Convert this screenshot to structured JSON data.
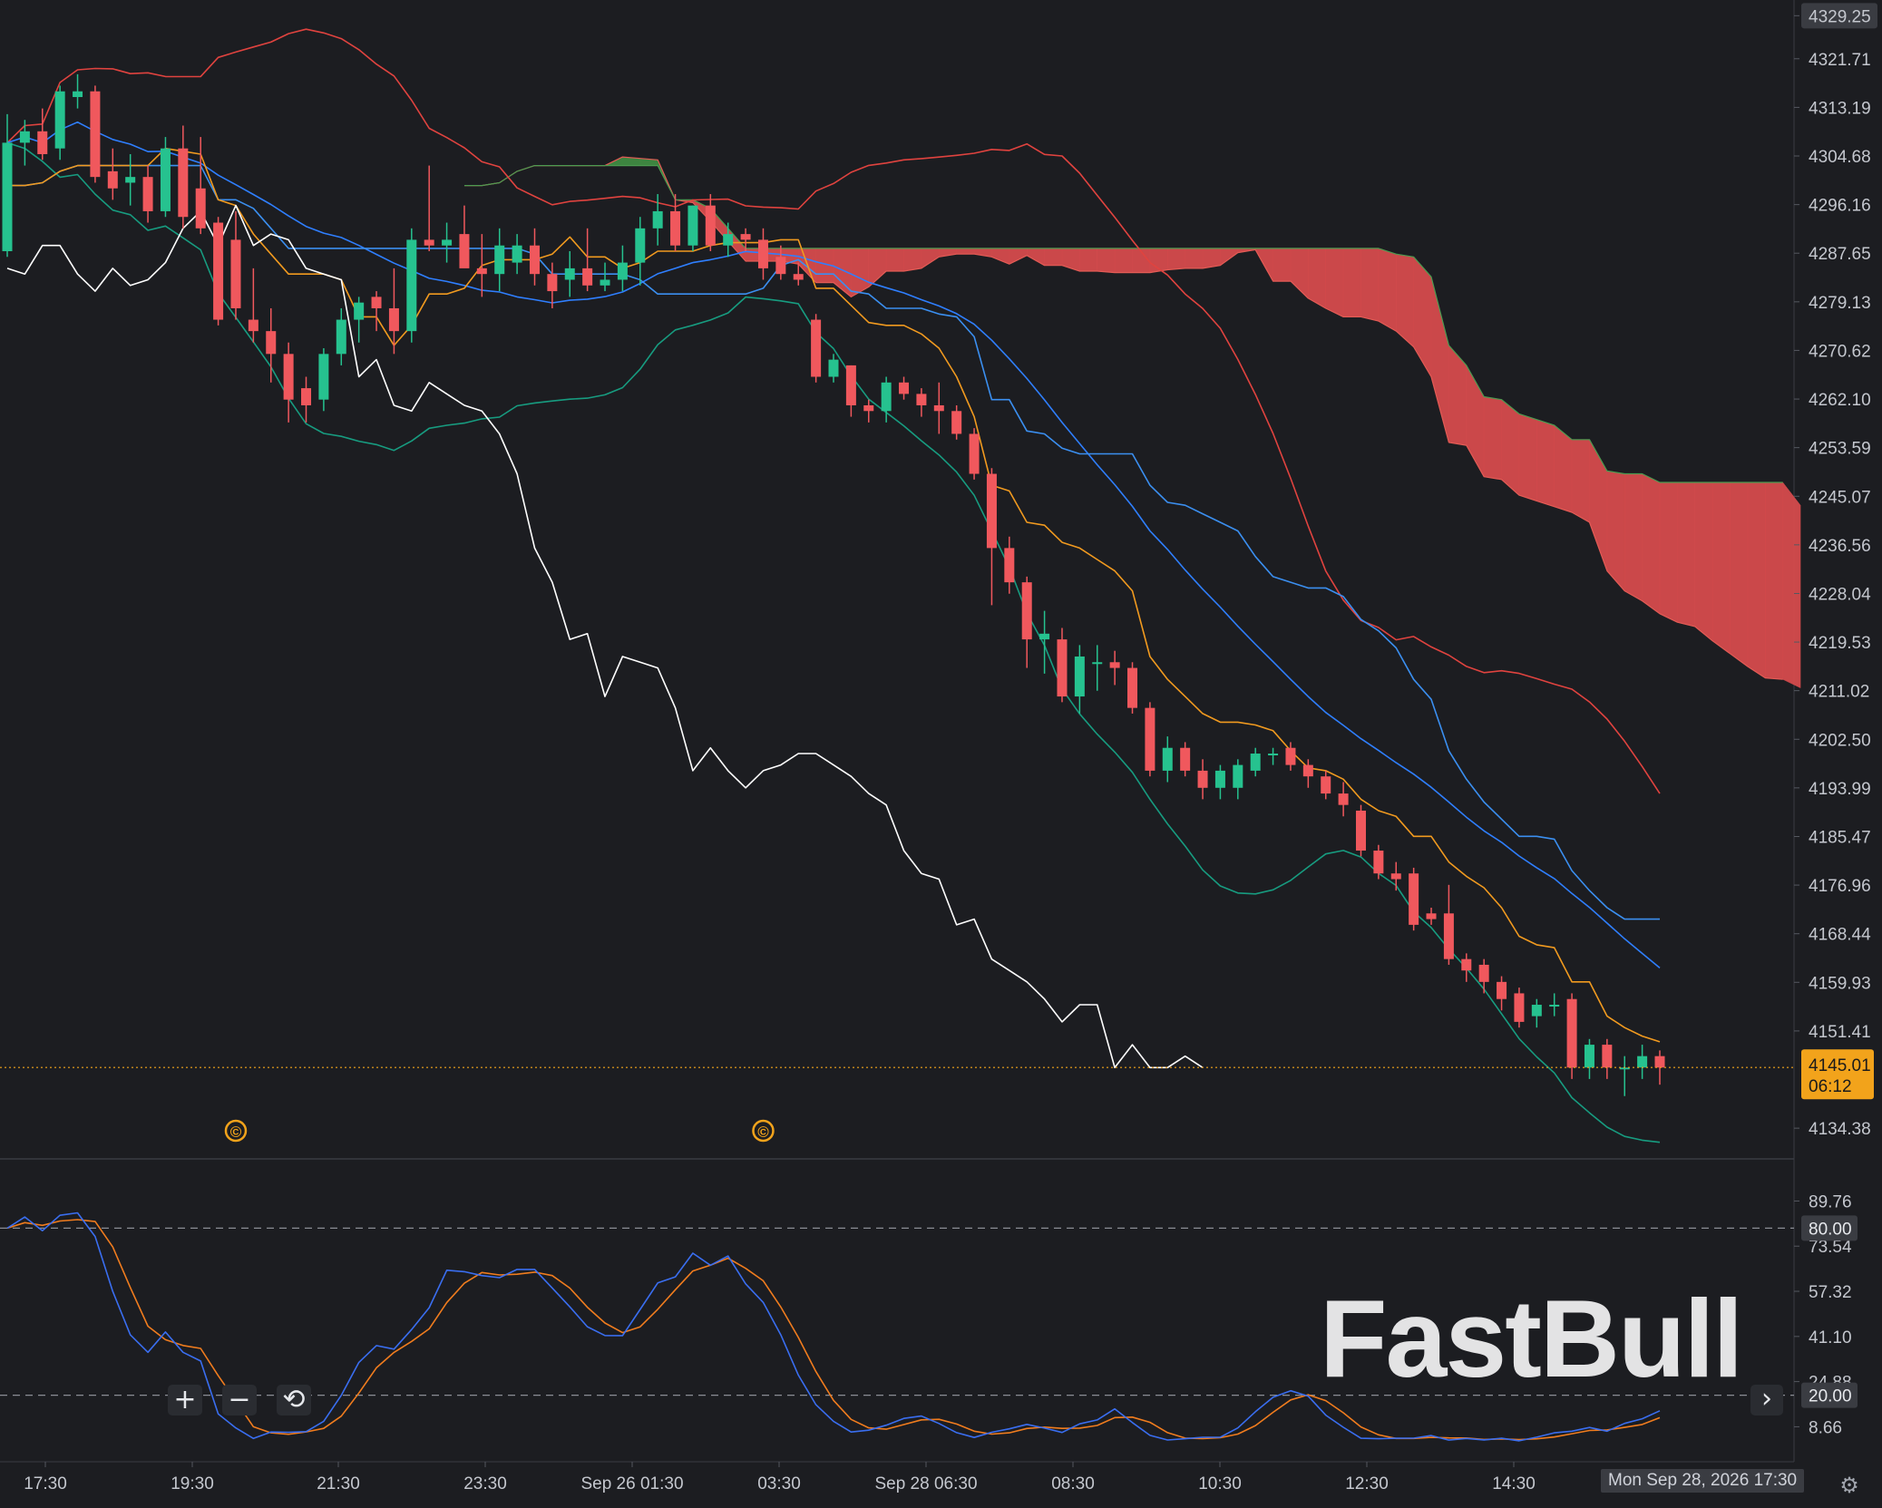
{
  "chart_data": {
    "type": "candlestick",
    "watermark": "FastBull",
    "price_axis": {
      "ylim": [
        4129.0,
        4332.0
      ],
      "ticks": [
        "4329.25",
        "4321.71",
        "4313.19",
        "4304.68",
        "4296.16",
        "4287.65",
        "4279.13",
        "4270.62",
        "4262.10",
        "4253.59",
        "4245.07",
        "4236.56",
        "4228.04",
        "4219.53",
        "4211.02",
        "4202.50",
        "4193.99",
        "4185.47",
        "4176.96",
        "4168.44",
        "4159.93",
        "4151.41",
        "4134.38"
      ]
    },
    "current_price": {
      "value": "4145.01",
      "countdown": "06:12"
    },
    "time_axis": {
      "ticks": [
        "17:30",
        "19:30",
        "21:30",
        "23:30",
        "Sep 26 01:30",
        "03:30",
        "Sep 28 06:30",
        "08:30",
        "10:30",
        "12:30",
        "14:30"
      ],
      "cursor_label": "Mon Sep 28, 2026 17:30"
    },
    "markers": [
      "©",
      "©"
    ],
    "candles": [
      {
        "o": 4288,
        "h": 4312,
        "l": 4287,
        "c": 4307
      },
      {
        "o": 4307,
        "h": 4311,
        "l": 4303,
        "c": 4309
      },
      {
        "o": 4309,
        "h": 4313,
        "l": 4304,
        "c": 4305
      },
      {
        "o": 4306,
        "h": 4317,
        "l": 4304,
        "c": 4316
      },
      {
        "o": 4315,
        "h": 4319,
        "l": 4313,
        "c": 4316
      },
      {
        "o": 4316,
        "h": 4317,
        "l": 4300,
        "c": 4301
      },
      {
        "o": 4302,
        "h": 4306,
        "l": 4297,
        "c": 4299
      },
      {
        "o": 4300,
        "h": 4305,
        "l": 4296,
        "c": 4301
      },
      {
        "o": 4301,
        "h": 4303,
        "l": 4293,
        "c": 4295
      },
      {
        "o": 4295,
        "h": 4308,
        "l": 4294,
        "c": 4306
      },
      {
        "o": 4306,
        "h": 4310,
        "l": 4292,
        "c": 4294
      },
      {
        "o": 4299,
        "h": 4308,
        "l": 4291,
        "c": 4292
      },
      {
        "o": 4293,
        "h": 4294,
        "l": 4275,
        "c": 4276
      },
      {
        "o": 4290,
        "h": 4295,
        "l": 4276,
        "c": 4278
      },
      {
        "o": 4276,
        "h": 4285,
        "l": 4272,
        "c": 4274
      },
      {
        "o": 4274,
        "h": 4278,
        "l": 4265,
        "c": 4270
      },
      {
        "o": 4270,
        "h": 4272,
        "l": 4258,
        "c": 4262
      },
      {
        "o": 4264,
        "h": 4266,
        "l": 4258,
        "c": 4261
      },
      {
        "o": 4262,
        "h": 4271,
        "l": 4260,
        "c": 4270
      },
      {
        "o": 4270,
        "h": 4278,
        "l": 4268,
        "c": 4276
      },
      {
        "o": 4276,
        "h": 4280,
        "l": 4272,
        "c": 4279
      },
      {
        "o": 4280,
        "h": 4281,
        "l": 4274,
        "c": 4278
      },
      {
        "o": 4278,
        "h": 4285,
        "l": 4270,
        "c": 4274
      },
      {
        "o": 4274,
        "h": 4292,
        "l": 4272,
        "c": 4290
      },
      {
        "o": 4290,
        "h": 4303,
        "l": 4288,
        "c": 4289
      },
      {
        "o": 4289,
        "h": 4293,
        "l": 4286,
        "c": 4290
      },
      {
        "o": 4291,
        "h": 4296,
        "l": 4286,
        "c": 4285
      },
      {
        "o": 4285,
        "h": 4291,
        "l": 4280,
        "c": 4284
      },
      {
        "o": 4284,
        "h": 4292,
        "l": 4281,
        "c": 4289
      },
      {
        "o": 4286,
        "h": 4291,
        "l": 4284,
        "c": 4289
      },
      {
        "o": 4289,
        "h": 4292,
        "l": 4282,
        "c": 4284
      },
      {
        "o": 4284,
        "h": 4286,
        "l": 4278,
        "c": 4281
      },
      {
        "o": 4283,
        "h": 4288,
        "l": 4280,
        "c": 4285
      },
      {
        "o": 4285,
        "h": 4292,
        "l": 4281,
        "c": 4282
      },
      {
        "o": 4282,
        "h": 4286,
        "l": 4281,
        "c": 4283
      },
      {
        "o": 4283,
        "h": 4289,
        "l": 4281,
        "c": 4286
      },
      {
        "o": 4286,
        "h": 4294,
        "l": 4282,
        "c": 4292
      },
      {
        "o": 4292,
        "h": 4298,
        "l": 4289,
        "c": 4295
      },
      {
        "o": 4295,
        "h": 4298,
        "l": 4288,
        "c": 4289
      },
      {
        "o": 4289,
        "h": 4296,
        "l": 4288,
        "c": 4296
      },
      {
        "o": 4296,
        "h": 4298,
        "l": 4288,
        "c": 4289
      },
      {
        "o": 4289,
        "h": 4293,
        "l": 4287,
        "c": 4291
      },
      {
        "o": 4291,
        "h": 4292,
        "l": 4288,
        "c": 4290
      },
      {
        "o": 4290,
        "h": 4292,
        "l": 4283,
        "c": 4285
      },
      {
        "o": 4287,
        "h": 4289,
        "l": 4283,
        "c": 4284
      },
      {
        "o": 4284,
        "h": 4286,
        "l": 4282,
        "c": 4283
      },
      {
        "o": 4276,
        "h": 4277,
        "l": 4265,
        "c": 4266
      },
      {
        "o": 4266,
        "h": 4270,
        "l": 4265,
        "c": 4269
      },
      {
        "o": 4268,
        "h": 4268,
        "l": 4259,
        "c": 4261
      },
      {
        "o": 4261,
        "h": 4262,
        "l": 4258,
        "c": 4260
      },
      {
        "o": 4260,
        "h": 4266,
        "l": 4258,
        "c": 4265
      },
      {
        "o": 4265,
        "h": 4266,
        "l": 4262,
        "c": 4263
      },
      {
        "o": 4263,
        "h": 4264,
        "l": 4259,
        "c": 4261
      },
      {
        "o": 4261,
        "h": 4265,
        "l": 4256,
        "c": 4260
      },
      {
        "o": 4260,
        "h": 4261,
        "l": 4255,
        "c": 4256
      },
      {
        "o": 4256,
        "h": 4257,
        "l": 4248,
        "c": 4249
      },
      {
        "o": 4249,
        "h": 4250,
        "l": 4226,
        "c": 4236
      },
      {
        "o": 4236,
        "h": 4238,
        "l": 4228,
        "c": 4230
      },
      {
        "o": 4230,
        "h": 4231,
        "l": 4215,
        "c": 4220
      },
      {
        "o": 4220,
        "h": 4225,
        "l": 4214,
        "c": 4221
      },
      {
        "o": 4220,
        "h": 4222,
        "l": 4209,
        "c": 4210
      },
      {
        "o": 4210,
        "h": 4219,
        "l": 4207,
        "c": 4217
      },
      {
        "o": 4216,
        "h": 4219,
        "l": 4211,
        "c": 4216
      },
      {
        "o": 4216,
        "h": 4218,
        "l": 4212,
        "c": 4215
      },
      {
        "o": 4215,
        "h": 4216,
        "l": 4207,
        "c": 4208
      },
      {
        "o": 4208,
        "h": 4209,
        "l": 4196,
        "c": 4197
      },
      {
        "o": 4197,
        "h": 4203,
        "l": 4195,
        "c": 4201
      },
      {
        "o": 4201,
        "h": 4202,
        "l": 4196,
        "c": 4197
      },
      {
        "o": 4197,
        "h": 4199,
        "l": 4192,
        "c": 4194
      },
      {
        "o": 4194,
        "h": 4198,
        "l": 4192,
        "c": 4197
      },
      {
        "o": 4194,
        "h": 4199,
        "l": 4192,
        "c": 4198
      },
      {
        "o": 4197,
        "h": 4201,
        "l": 4196,
        "c": 4200
      },
      {
        "o": 4200,
        "h": 4201,
        "l": 4198,
        "c": 4200
      },
      {
        "o": 4201,
        "h": 4202,
        "l": 4197,
        "c": 4198
      },
      {
        "o": 4198,
        "h": 4199,
        "l": 4194,
        "c": 4196
      },
      {
        "o": 4196,
        "h": 4197,
        "l": 4192,
        "c": 4193
      },
      {
        "o": 4193,
        "h": 4195,
        "l": 4189,
        "c": 4191
      },
      {
        "o": 4190,
        "h": 4191,
        "l": 4182,
        "c": 4183
      },
      {
        "o": 4183,
        "h": 4184,
        "l": 4178,
        "c": 4179
      },
      {
        "o": 4179,
        "h": 4181,
        "l": 4176,
        "c": 4178
      },
      {
        "o": 4179,
        "h": 4180,
        "l": 4169,
        "c": 4170
      },
      {
        "o": 4172,
        "h": 4173,
        "l": 4170,
        "c": 4171
      },
      {
        "o": 4172,
        "h": 4177,
        "l": 4163,
        "c": 4164
      },
      {
        "o": 4164,
        "h": 4165,
        "l": 4160,
        "c": 4162
      },
      {
        "o": 4163,
        "h": 4164,
        "l": 4158,
        "c": 4160
      },
      {
        "o": 4160,
        "h": 4161,
        "l": 4155,
        "c": 4157
      },
      {
        "o": 4158,
        "h": 4159,
        "l": 4152,
        "c": 4153
      },
      {
        "o": 4154,
        "h": 4157,
        "l": 4152,
        "c": 4156
      },
      {
        "o": 4156,
        "h": 4158,
        "l": 4154,
        "c": 4156
      },
      {
        "o": 4157,
        "h": 4158,
        "l": 4143,
        "c": 4145
      },
      {
        "o": 4145,
        "h": 4150,
        "l": 4143,
        "c": 4149
      },
      {
        "o": 4149,
        "h": 4150,
        "l": 4143,
        "c": 4145
      },
      {
        "o": 4145,
        "h": 4147,
        "l": 4140,
        "c": 4145
      },
      {
        "o": 4145,
        "h": 4149,
        "l": 4143,
        "c": 4147
      },
      {
        "o": 4147,
        "h": 4148,
        "l": 4142,
        "c": 4145
      }
    ],
    "stochastic": {
      "axis_ticks": [
        "89.76",
        "73.54",
        "57.32",
        "41.10",
        "24.88",
        "8.66"
      ],
      "levels": [
        "80.00",
        "20.00"
      ],
      "ylim": [
        0,
        100
      ]
    }
  },
  "colors": {
    "background": "#1c1d21",
    "up": "#26c28f",
    "down": "#f0585d",
    "bb_upper": "#e0433f",
    "bb_mid": "#2f7fff",
    "bb_lower": "#179c80",
    "tenkan": "#f19a1f",
    "kijun": "#3b8ff0",
    "chikou": "#ffffff",
    "cloud_bull": "#3f8a42",
    "cloud_bear": "#d54b4d",
    "stoch_k": "#3a6ef0",
    "stoch_d": "#f07c1e",
    "price_tag": "#f2a31b"
  },
  "controls": {
    "zoom_in": "+",
    "zoom_out": "−",
    "reset": "⟲",
    "scroll_right": "›",
    "settings": "⚙"
  }
}
